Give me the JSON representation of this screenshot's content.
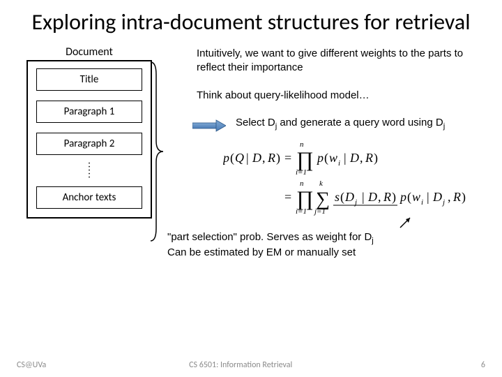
{
  "title": "Exploring intra-document structures for retrieval",
  "doc": {
    "label": "Document",
    "parts": [
      "Title",
      "Paragraph 1",
      "Paragraph 2",
      "Anchor texts"
    ]
  },
  "right": {
    "p1": "Intuitively, we want to give different weights to the parts to reflect their importance",
    "p2": "Think about query-likelihood model…",
    "p3a": "Select D",
    "p3b": " and generate a query word using D"
  },
  "formula": {
    "line1": "p(Q | D, R) = ∏_{i=1}^{n} p(w_i | D, R)",
    "line2": "= ∏_{i=1}^{n} ∑_{j=1}^{k} s(D_j | D, R) p(w_i | D_j, R)"
  },
  "caption": {
    "l1a": "\"part selection\" prob. Serves as weight for D",
    "l2": "Can be estimated by EM or manually set"
  },
  "footer": {
    "left": "CS@UVa",
    "mid": "CS 6501: Information Retrieval",
    "right": "6"
  }
}
